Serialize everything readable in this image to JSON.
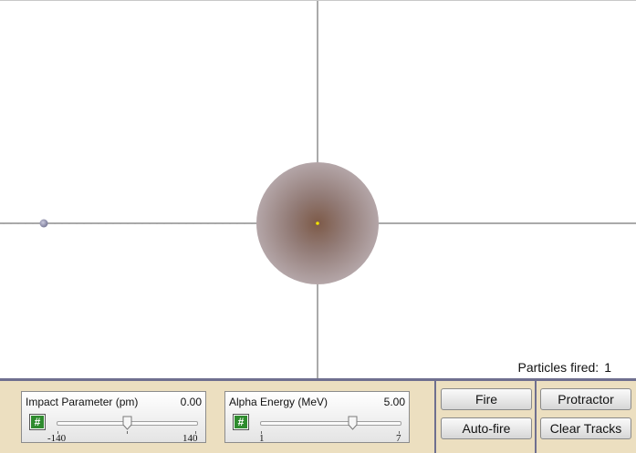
{
  "simulation": {
    "particles_fired_label": "Particles fired:",
    "particles_fired_count": "1",
    "nucleus_color": "#9c8a8a",
    "nucleus_center_color": "#f2e200",
    "alpha_particle_color": "#8e8ea8"
  },
  "controls": {
    "impact_parameter": {
      "label": "Impact Parameter (pm)",
      "value": "0.00",
      "min": "-140",
      "max": "140",
      "position_value": 0.0,
      "toggle_icon": "hash-icon"
    },
    "alpha_energy": {
      "label": "Alpha Energy (MeV)",
      "value": "5.00",
      "min": "1",
      "max": "7",
      "position_value": 5.0,
      "toggle_icon": "hash-icon"
    },
    "buttons": {
      "fire": "Fire",
      "auto_fire": "Auto-fire",
      "protractor": "Protractor",
      "clear_tracks": "Clear Tracks"
    }
  }
}
